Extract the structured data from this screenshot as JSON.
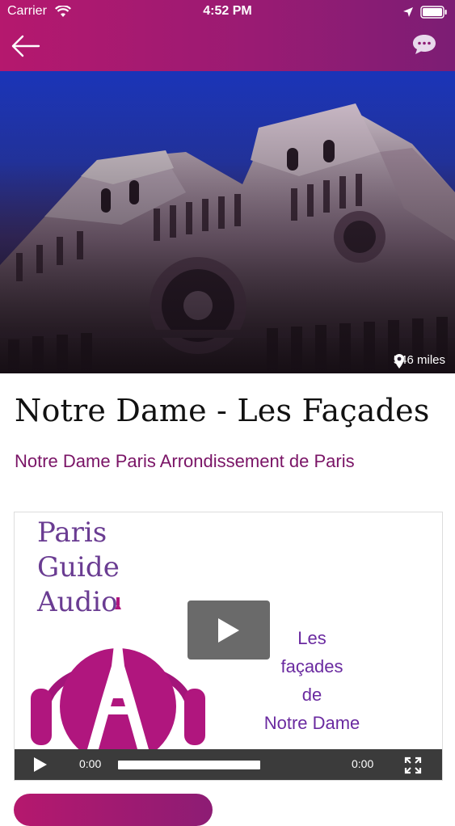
{
  "status_bar": {
    "carrier": "Carrier",
    "time": "4:52 PM"
  },
  "nav": {
    "back_icon": "arrow-left-icon",
    "chat_icon": "chat-bubble-icon",
    "colors": {
      "gradient_start": "#b5186e",
      "gradient_end": "#7c1d74"
    }
  },
  "hero": {
    "distance": "546 miles",
    "distance_icon": "map-pin-icon"
  },
  "place": {
    "title": "Notre Dame - Les Façades",
    "subtitle": "Notre Dame Paris Arrondissement de Paris"
  },
  "video": {
    "poster_left_lines": [
      "Paris",
      "Guide",
      "Audio"
    ],
    "poster_right_lines": [
      "Les",
      "façades",
      "de",
      "Notre Dame"
    ],
    "current_time": "0:00",
    "duration": "0:00",
    "progress": 0,
    "icons": [
      "play-icon",
      "fullscreen-icon"
    ]
  }
}
